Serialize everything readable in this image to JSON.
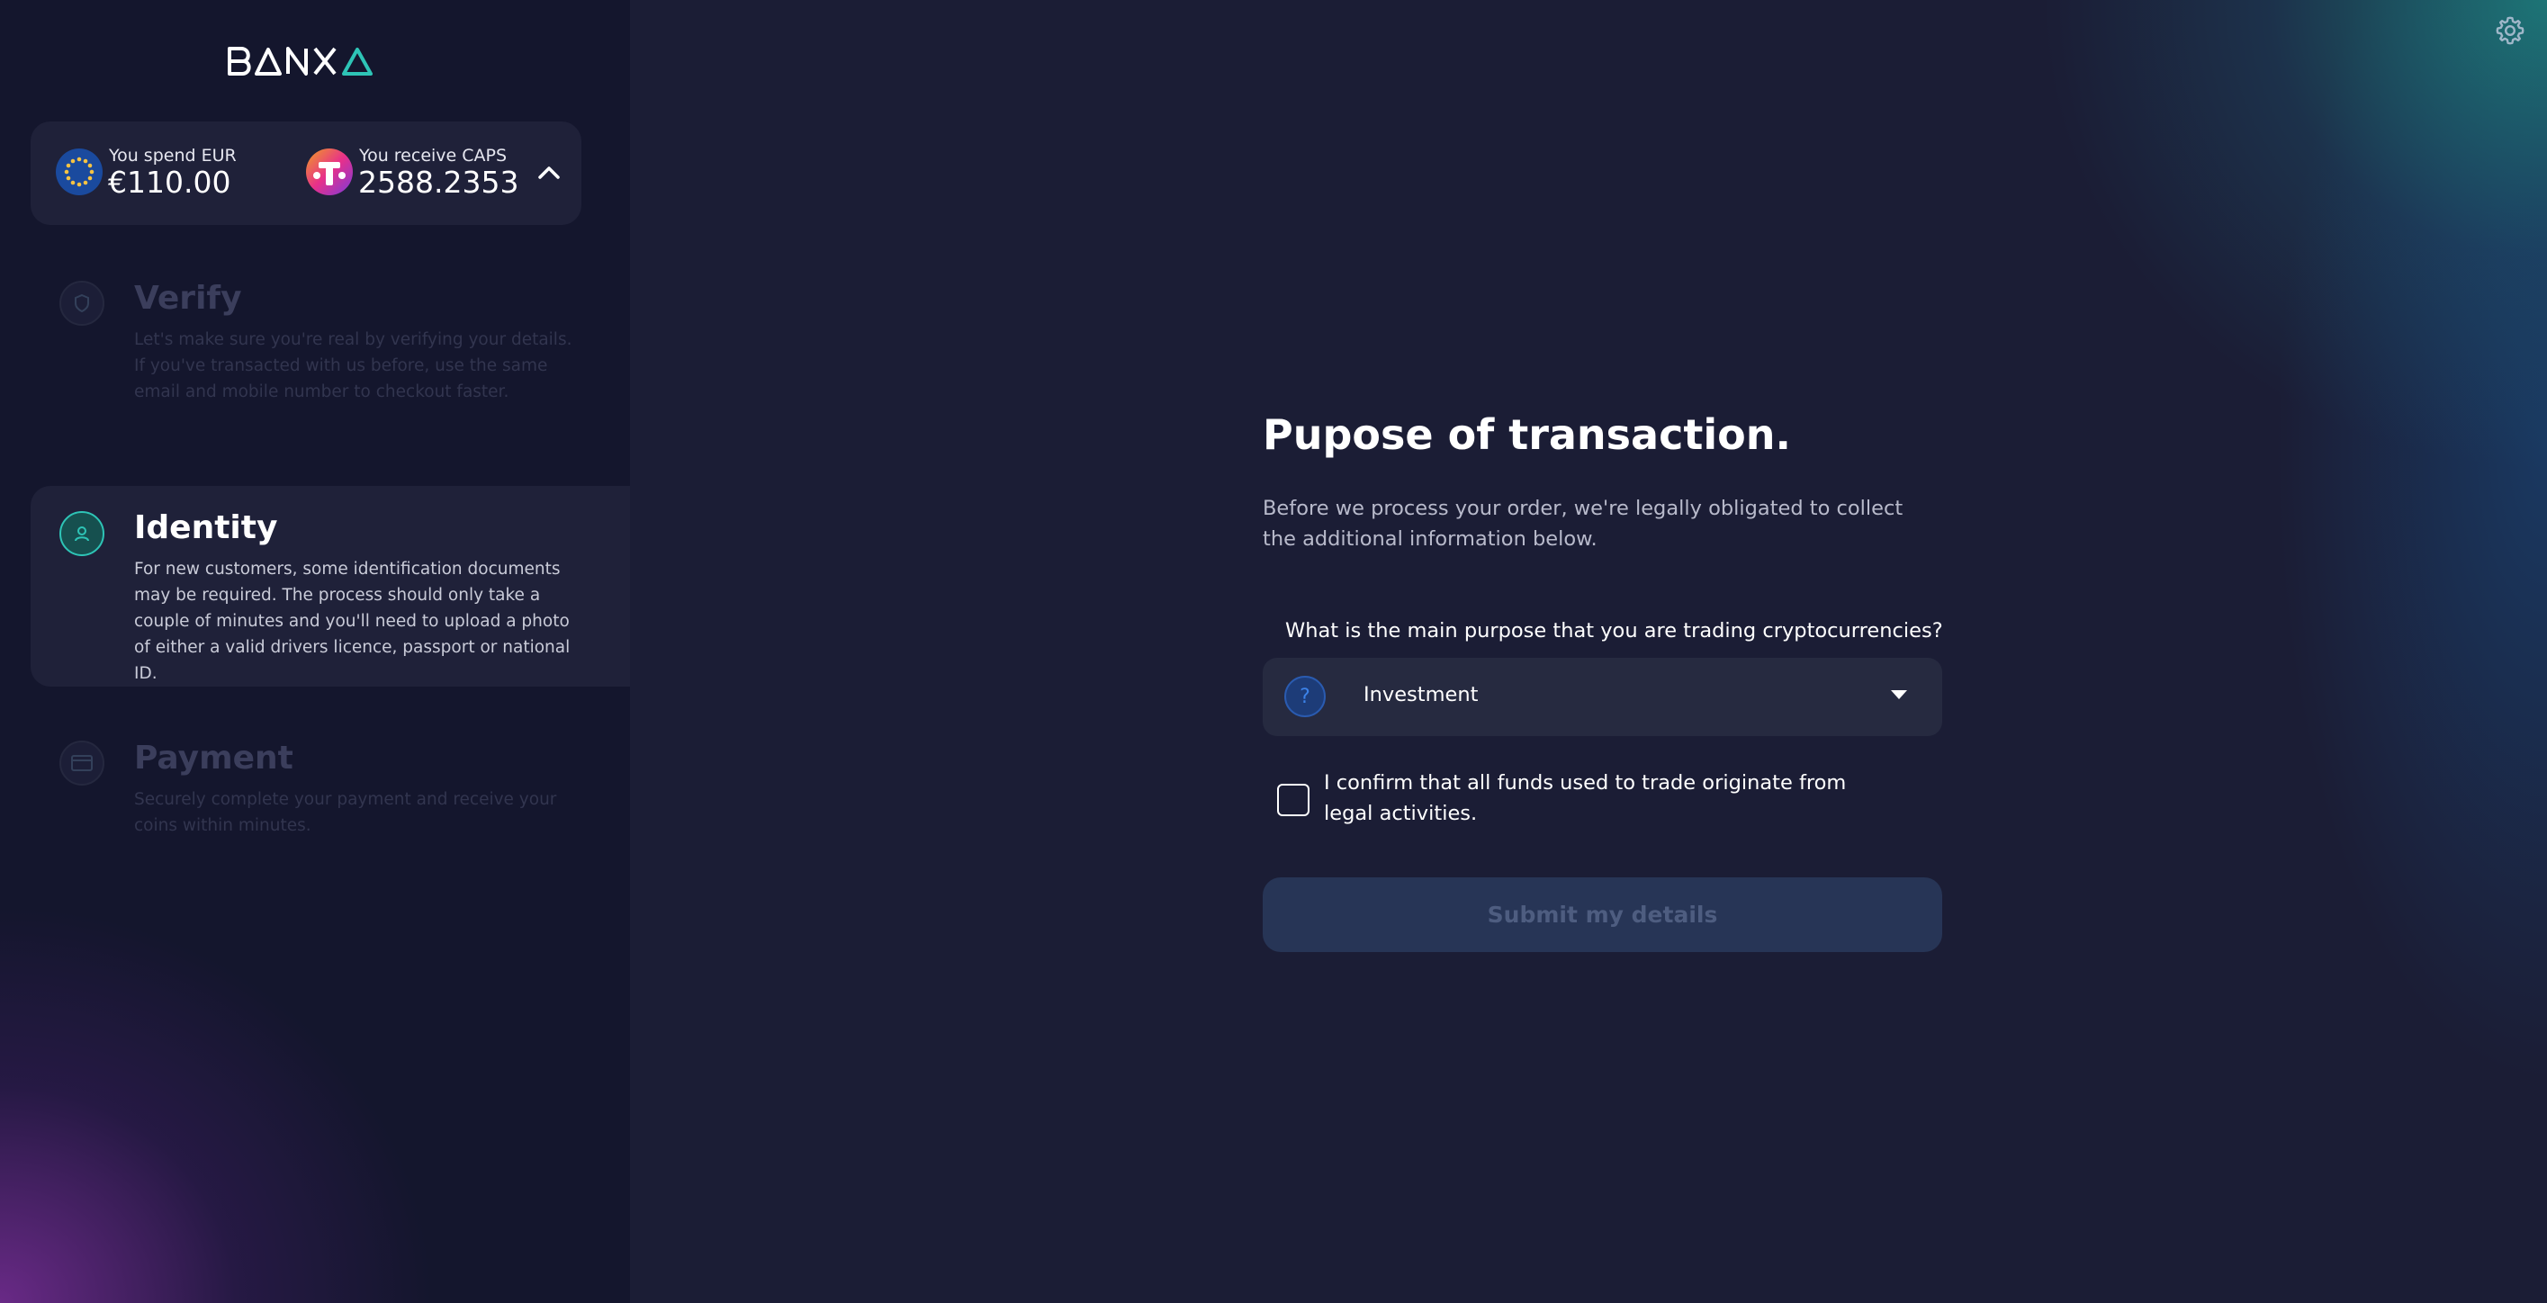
{
  "brand": {
    "name": "BANXA",
    "accent": "#2ec4b6"
  },
  "summary": {
    "spend_label": "You spend EUR",
    "spend_value": "€110.00",
    "spend_icon": "eu-flag-icon",
    "receive_label": "You receive CAPS",
    "receive_value": "2588.2353",
    "receive_icon": "caps-coin-icon",
    "toggle_icon": "chevron-up-icon"
  },
  "steps": [
    {
      "title": "Verify",
      "description": "Let's make sure you're real by verifying your details. If you've transacted with us before, use the same email and mobile number to checkout faster.",
      "icon": "shield-icon",
      "state": "inactive"
    },
    {
      "title": "Identity",
      "description": "For new customers, some identification documents may be required. The process should only take a couple of minutes and you'll need to upload a photo of either a valid drivers licence, passport or national ID.",
      "icon": "user-icon",
      "state": "active"
    },
    {
      "title": "Payment",
      "description": "Securely complete your payment and receive your coins within minutes.",
      "icon": "credit-card-icon",
      "state": "inactive"
    }
  ],
  "form": {
    "title": "Pupose of transaction.",
    "intro": "Before we process your order, we're legally obligated to collect the additional information below.",
    "question": "What is the main purpose that you are trading cryptocurrencies?",
    "question_icon_glyph": "?",
    "selected": "Investment",
    "confirm_text": "I confirm that all funds used to trade originate from legal activities.",
    "confirm_checked": false,
    "submit_label": "Submit my details"
  },
  "settings_icon": "gear-icon"
}
